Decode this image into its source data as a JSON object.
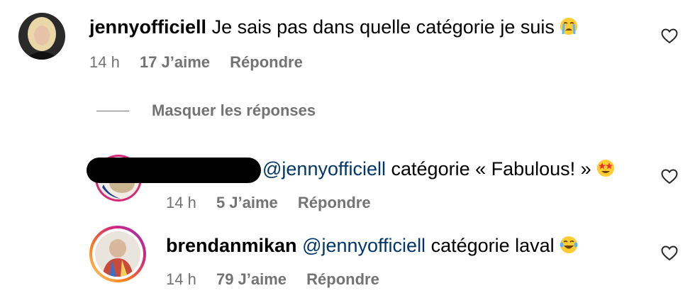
{
  "comments": [
    {
      "username": "jennyofficiell",
      "text": "Je sais pas dans quelle catégorie je suis",
      "emoji_icon": "loudly-crying-face-emoji",
      "time": "14 h",
      "likes": "17 J’aime",
      "reply": "Répondre"
    }
  ],
  "replies_toggle": "Masquer les réponses",
  "replies": [
    {
      "username": "",
      "mention": "@jennyofficiell",
      "text": "catégorie « Fabulous! »",
      "emoji_icon": "star-struck-emoji",
      "time": "14 h",
      "likes": "5 J’aime",
      "reply": "Répondre"
    },
    {
      "username": "brendanmikan",
      "mention": "@jennyofficiell",
      "text": "catégorie laval",
      "emoji_icon": "tears-of-joy-emoji",
      "time": "14 h",
      "likes": "79 J’aime",
      "reply": "Répondre"
    }
  ],
  "icons": {
    "like": "heart-outline-icon"
  },
  "colors": {
    "mention": "#00376b",
    "meta": "#737373",
    "story_ring": "#d62976"
  }
}
